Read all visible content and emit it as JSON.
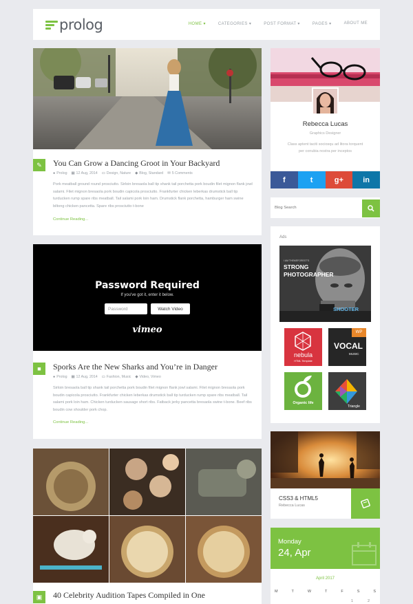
{
  "header": {
    "logo_text": "prolog",
    "nav": [
      "HOME ▾",
      "CATEGORIES ▾",
      "POST FORMAT ▾",
      "PAGES ▾",
      "ABOUT ME"
    ]
  },
  "posts": [
    {
      "title": "You Can Grow a Dancing Groot in Your Backyard",
      "author": "Prolog",
      "date": "12 Aug, 2014",
      "categories": "Design, Nature",
      "tags": "Blog, Standard",
      "comments": "5 Comments",
      "excerpt": "Pork meatball ground round prosciutto. Sirloin bresaola ball tip shank tail porchetta pork boudin filet mignon flank jowl salami. Filet mignon bresaola pork boudin capicola prosciutto. Frankfurter chicken leberkas drumstick ball tip turducken rump spare ribs meatball. Tail salami pork loin ham. Drumstick flank porchetta, hamburger ham swine biltong chicken pancetta. Spare ribs prosciutto t-bone",
      "read_more": "Continue Reading...",
      "format_icon": "pin-icon"
    },
    {
      "title": "Sporks Are the New Sharks and You’re in Danger",
      "author": "Prolog",
      "date": "12 Aug, 2014",
      "categories": "Fashion, Music",
      "tags": "Video, Vimeo",
      "excerpt": "Sirloin bresaola ball tip shank tail porchetta pork boudin filet mignon flank jowl salami. Filet mignon bresaola pork boudin capicola prosciutto. Frankfurter chicken leberkas drumstick ball tip turducken rump spare ribs meatball. Tail salami pork loin ham. Chicken turducken sausage short ribs. Fatback jerky pancetta bresaola swine t-bone. Beef ribs boudin cow shoulder pork chop.",
      "read_more": "Continue Reading...",
      "format_icon": "video-camera-icon",
      "video": {
        "heading": "Password Required",
        "sub": "If you've got it, enter it below.",
        "password_placeholder": "Password",
        "watch_label": "Watch Video",
        "brand": "vimeo"
      }
    },
    {
      "title": "40 Celebrity Audition Tapes Compiled in One",
      "format_icon": "image-icon"
    }
  ],
  "profile": {
    "name": "Rebecca Lucas",
    "role": "Graphics Designer",
    "bio": "Class aptent taciti sociosqu ad litora torquent per conubia nostra per inceptos"
  },
  "social": {
    "facebook": "f",
    "twitter": "t",
    "google": "g+",
    "linkedin": "in",
    "colors": {
      "facebook": "#3b5998",
      "twitter": "#1da1f2",
      "google": "#dd4b39",
      "linkedin": "#0e76a8"
    }
  },
  "search": {
    "placeholder": "Blog Search"
  },
  "ads": {
    "label": "Ads",
    "poster": {
      "lines": [
        "STRONG",
        "PHOTOGRAPHER"
      ],
      "small": "I AM THEMEFOREST'S",
      "shooter": "SHOOTER"
    },
    "tiles": [
      {
        "name": "nebula",
        "sub": "HTML Template",
        "color": "#d8343f"
      },
      {
        "name": "VOCAL",
        "badge": "WP",
        "sub": "MUSIC",
        "color": "#262626"
      },
      {
        "name": "Organic life",
        "color": "#6cb33f"
      },
      {
        "name": "Triangle",
        "color": "#3d3d3d"
      }
    ]
  },
  "featured": {
    "title": "CSS3 & HTML5",
    "author": "Rebecca Lucas"
  },
  "calendar": {
    "weekday": "Monday",
    "date": "24, Apr",
    "month": "April 2017",
    "days": [
      "M",
      "T",
      "W",
      "T",
      "F",
      "S",
      "S"
    ],
    "first_row": [
      "1",
      "2"
    ]
  },
  "accent_color": "#7dc242"
}
